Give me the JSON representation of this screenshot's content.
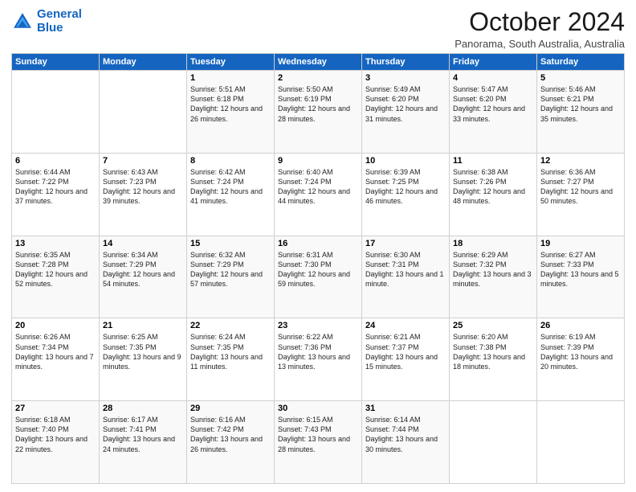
{
  "header": {
    "logo_line1": "General",
    "logo_line2": "Blue",
    "title": "October 2024",
    "subtitle": "Panorama, South Australia, Australia"
  },
  "weekdays": [
    "Sunday",
    "Monday",
    "Tuesday",
    "Wednesday",
    "Thursday",
    "Friday",
    "Saturday"
  ],
  "weeks": [
    [
      {
        "day": "",
        "content": ""
      },
      {
        "day": "",
        "content": ""
      },
      {
        "day": "1",
        "content": "Sunrise: 5:51 AM\nSunset: 6:18 PM\nDaylight: 12 hours\nand 26 minutes."
      },
      {
        "day": "2",
        "content": "Sunrise: 5:50 AM\nSunset: 6:19 PM\nDaylight: 12 hours\nand 28 minutes."
      },
      {
        "day": "3",
        "content": "Sunrise: 5:49 AM\nSunset: 6:20 PM\nDaylight: 12 hours\nand 31 minutes."
      },
      {
        "day": "4",
        "content": "Sunrise: 5:47 AM\nSunset: 6:20 PM\nDaylight: 12 hours\nand 33 minutes."
      },
      {
        "day": "5",
        "content": "Sunrise: 5:46 AM\nSunset: 6:21 PM\nDaylight: 12 hours\nand 35 minutes."
      }
    ],
    [
      {
        "day": "6",
        "content": "Sunrise: 6:44 AM\nSunset: 7:22 PM\nDaylight: 12 hours\nand 37 minutes."
      },
      {
        "day": "7",
        "content": "Sunrise: 6:43 AM\nSunset: 7:23 PM\nDaylight: 12 hours\nand 39 minutes."
      },
      {
        "day": "8",
        "content": "Sunrise: 6:42 AM\nSunset: 7:24 PM\nDaylight: 12 hours\nand 41 minutes."
      },
      {
        "day": "9",
        "content": "Sunrise: 6:40 AM\nSunset: 7:24 PM\nDaylight: 12 hours\nand 44 minutes."
      },
      {
        "day": "10",
        "content": "Sunrise: 6:39 AM\nSunset: 7:25 PM\nDaylight: 12 hours\nand 46 minutes."
      },
      {
        "day": "11",
        "content": "Sunrise: 6:38 AM\nSunset: 7:26 PM\nDaylight: 12 hours\nand 48 minutes."
      },
      {
        "day": "12",
        "content": "Sunrise: 6:36 AM\nSunset: 7:27 PM\nDaylight: 12 hours\nand 50 minutes."
      }
    ],
    [
      {
        "day": "13",
        "content": "Sunrise: 6:35 AM\nSunset: 7:28 PM\nDaylight: 12 hours\nand 52 minutes."
      },
      {
        "day": "14",
        "content": "Sunrise: 6:34 AM\nSunset: 7:29 PM\nDaylight: 12 hours\nand 54 minutes."
      },
      {
        "day": "15",
        "content": "Sunrise: 6:32 AM\nSunset: 7:29 PM\nDaylight: 12 hours\nand 57 minutes."
      },
      {
        "day": "16",
        "content": "Sunrise: 6:31 AM\nSunset: 7:30 PM\nDaylight: 12 hours\nand 59 minutes."
      },
      {
        "day": "17",
        "content": "Sunrise: 6:30 AM\nSunset: 7:31 PM\nDaylight: 13 hours\nand 1 minute."
      },
      {
        "day": "18",
        "content": "Sunrise: 6:29 AM\nSunset: 7:32 PM\nDaylight: 13 hours\nand 3 minutes."
      },
      {
        "day": "19",
        "content": "Sunrise: 6:27 AM\nSunset: 7:33 PM\nDaylight: 13 hours\nand 5 minutes."
      }
    ],
    [
      {
        "day": "20",
        "content": "Sunrise: 6:26 AM\nSunset: 7:34 PM\nDaylight: 13 hours\nand 7 minutes."
      },
      {
        "day": "21",
        "content": "Sunrise: 6:25 AM\nSunset: 7:35 PM\nDaylight: 13 hours\nand 9 minutes."
      },
      {
        "day": "22",
        "content": "Sunrise: 6:24 AM\nSunset: 7:35 PM\nDaylight: 13 hours\nand 11 minutes."
      },
      {
        "day": "23",
        "content": "Sunrise: 6:22 AM\nSunset: 7:36 PM\nDaylight: 13 hours\nand 13 minutes."
      },
      {
        "day": "24",
        "content": "Sunrise: 6:21 AM\nSunset: 7:37 PM\nDaylight: 13 hours\nand 15 minutes."
      },
      {
        "day": "25",
        "content": "Sunrise: 6:20 AM\nSunset: 7:38 PM\nDaylight: 13 hours\nand 18 minutes."
      },
      {
        "day": "26",
        "content": "Sunrise: 6:19 AM\nSunset: 7:39 PM\nDaylight: 13 hours\nand 20 minutes."
      }
    ],
    [
      {
        "day": "27",
        "content": "Sunrise: 6:18 AM\nSunset: 7:40 PM\nDaylight: 13 hours\nand 22 minutes."
      },
      {
        "day": "28",
        "content": "Sunrise: 6:17 AM\nSunset: 7:41 PM\nDaylight: 13 hours\nand 24 minutes."
      },
      {
        "day": "29",
        "content": "Sunrise: 6:16 AM\nSunset: 7:42 PM\nDaylight: 13 hours\nand 26 minutes."
      },
      {
        "day": "30",
        "content": "Sunrise: 6:15 AM\nSunset: 7:43 PM\nDaylight: 13 hours\nand 28 minutes."
      },
      {
        "day": "31",
        "content": "Sunrise: 6:14 AM\nSunset: 7:44 PM\nDaylight: 13 hours\nand 30 minutes."
      },
      {
        "day": "",
        "content": ""
      },
      {
        "day": "",
        "content": ""
      }
    ]
  ]
}
